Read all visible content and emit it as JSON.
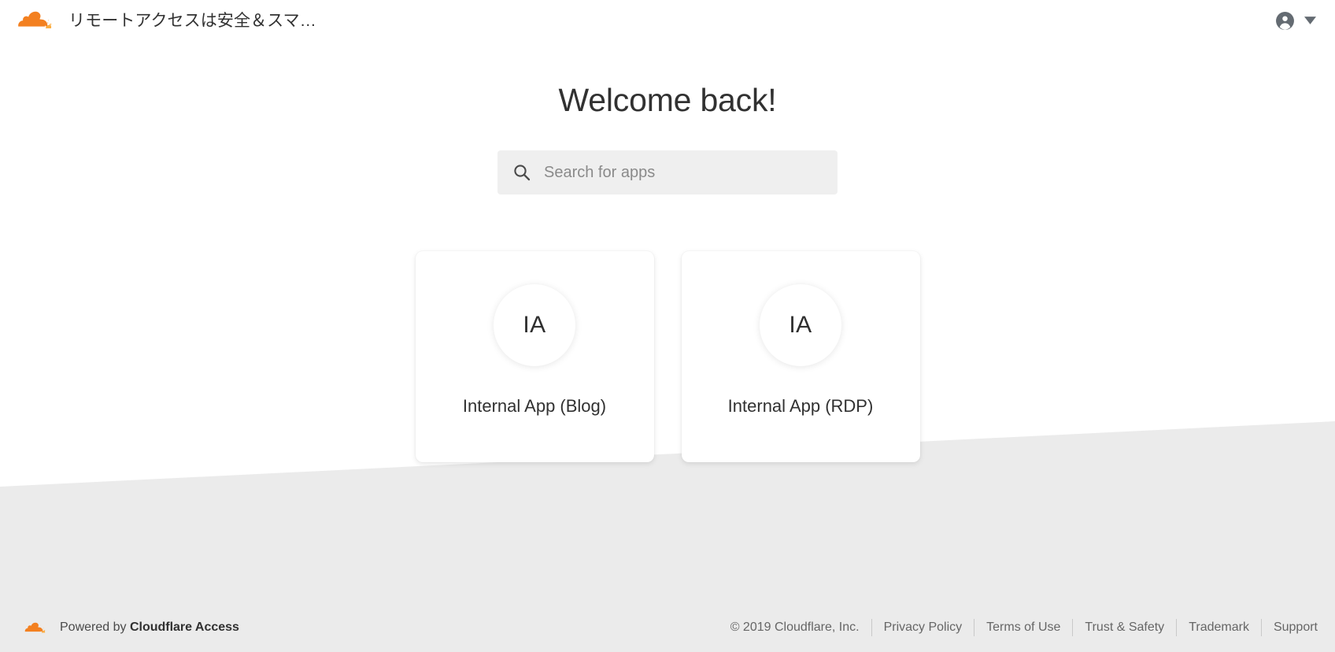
{
  "page": {
    "background_color": "#ffffff",
    "wedge_color": "#ebebeb"
  },
  "header": {
    "logo_icon": "cloudflare-cloud-icon",
    "title": "リモートアクセスは安全＆スマ…",
    "account": {
      "avatar_icon": "account-circle-icon",
      "chevron_icon": "chevron-down-icon"
    }
  },
  "main": {
    "heading": "Welcome back!",
    "search": {
      "icon": "search-icon",
      "placeholder": "Search for apps",
      "value": ""
    },
    "apps": [
      {
        "initials": "IA",
        "name": "Internal App (Blog)"
      },
      {
        "initials": "IA",
        "name": "Internal App (RDP)"
      }
    ]
  },
  "footer": {
    "logo_icon": "cloudflare-cloud-icon",
    "powered_prefix": "Powered by ",
    "powered_brand": "Cloudflare Access",
    "copyright": "© 2019 Cloudflare, Inc.",
    "links": [
      "Privacy Policy",
      "Terms of Use",
      "Trust & Safety",
      "Trademark",
      "Support"
    ]
  },
  "colors": {
    "cloudflare_orange_dark": "#f38020",
    "cloudflare_orange_light": "#fbad41",
    "text_primary": "#313131",
    "text_muted": "#666666",
    "search_background": "#efefef"
  }
}
